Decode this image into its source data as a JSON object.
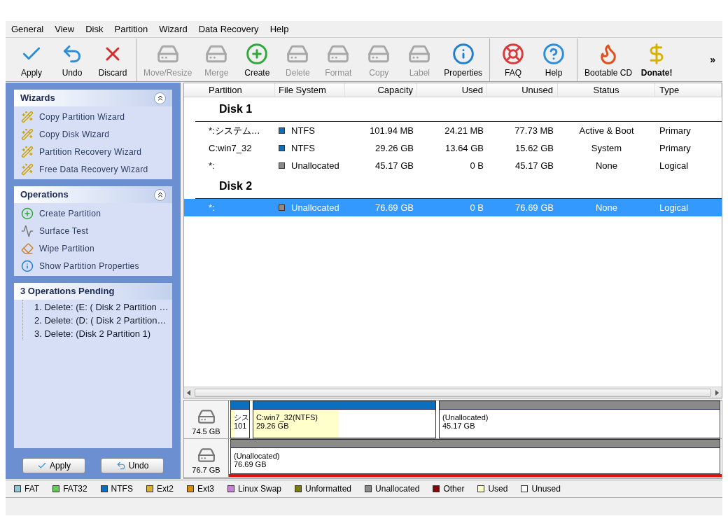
{
  "menu": [
    "General",
    "View",
    "Disk",
    "Partition",
    "Wizard",
    "Data Recovery",
    "Help"
  ],
  "toolbar": {
    "groups": [
      [
        {
          "label": "Apply",
          "disabled": false,
          "bold": false
        },
        {
          "label": "Undo",
          "disabled": false,
          "bold": false
        },
        {
          "label": "Discard",
          "disabled": false,
          "bold": false
        }
      ],
      [
        {
          "label": "Move/Resize",
          "disabled": true,
          "bold": false
        },
        {
          "label": "Merge",
          "disabled": true,
          "bold": false
        },
        {
          "label": "Create",
          "disabled": false,
          "bold": false
        },
        {
          "label": "Delete",
          "disabled": true,
          "bold": false
        },
        {
          "label": "Format",
          "disabled": true,
          "bold": false
        },
        {
          "label": "Copy",
          "disabled": true,
          "bold": false
        },
        {
          "label": "Label",
          "disabled": true,
          "bold": false
        },
        {
          "label": "Properties",
          "disabled": false,
          "bold": false
        }
      ],
      [
        {
          "label": "FAQ",
          "disabled": false,
          "bold": false
        },
        {
          "label": "Help",
          "disabled": false,
          "bold": false
        }
      ],
      [
        {
          "label": "Bootable CD",
          "disabled": false,
          "bold": false
        },
        {
          "label": "Donate!",
          "disabled": false,
          "bold": true
        }
      ]
    ],
    "overflow": "»"
  },
  "sidebar": {
    "wizards": {
      "title": "Wizards",
      "expanded": true,
      "items": [
        "Copy Partition Wizard",
        "Copy Disk Wizard",
        "Partition Recovery Wizard",
        "Free Data Recovery Wizard"
      ]
    },
    "operations": {
      "title": "Operations",
      "expanded": true,
      "items": [
        "Create Partition",
        "Surface Test",
        "Wipe Partition",
        "Show Partition Properties"
      ]
    },
    "pending": {
      "title": "3 Operations Pending",
      "items": [
        "1. Delete: (E: ( Disk 2 Partition …",
        "2. Delete: (D: ( Disk 2 Partition…",
        "3. Delete: (Disk 2 Partition 1)"
      ]
    },
    "buttons": [
      "Apply",
      "Undo"
    ]
  },
  "table": {
    "columns": [
      "Partition",
      "File System",
      "Capacity",
      "Used",
      "Unused",
      "Status",
      "Type"
    ],
    "rows": [
      {
        "kind": "disk",
        "label": "Disk 1"
      },
      {
        "kind": "partition",
        "selected": false,
        "partition": "*:システム…",
        "file_system": "NTFS",
        "color": "#0b6fc0",
        "capacity": "101.94 MB",
        "used": "24.21 MB",
        "unused": "77.73 MB",
        "status": "Active & Boot",
        "type": "Primary"
      },
      {
        "kind": "partition",
        "selected": false,
        "partition": "C:win7_32",
        "file_system": "NTFS",
        "color": "#0b6fc0",
        "capacity": "29.26 GB",
        "used": "13.64 GB",
        "unused": "15.62 GB",
        "status": "System",
        "type": "Primary"
      },
      {
        "kind": "partition",
        "selected": false,
        "partition": "*:",
        "file_system": "Unallocated",
        "color": "#8a8a8a",
        "capacity": "45.17 GB",
        "used": "0 B",
        "unused": "45.17 GB",
        "status": "None",
        "type": "Logical"
      },
      {
        "kind": "disk",
        "label": "Disk 2"
      },
      {
        "kind": "partition",
        "selected": true,
        "partition": "*:",
        "file_system": "Unallocated",
        "color": "#8a8a8a",
        "capacity": "76.69 GB",
        "used": "0 B",
        "unused": "76.69 GB",
        "status": "None",
        "type": "Logical"
      }
    ]
  },
  "disk_map": [
    {
      "size": "74.5 GB",
      "selected": false,
      "partitions": [
        {
          "name": "シス",
          "size": "101",
          "color": "#0b6fc0",
          "level": 0.24
        },
        {
          "name": "C:win7_32(NTFS)",
          "size": "29.26 GB",
          "color": "#0b6fc0",
          "level": 0.47
        },
        {
          "name": "(Unallocated)",
          "size": "45.17 GB",
          "color": "#8a8a8a"
        }
      ]
    },
    {
      "size": "76.7 GB",
      "selected": true,
      "partitions": [
        {
          "name": "(Unallocated)",
          "size": "76.69 GB",
          "color": "#8a8a8a"
        }
      ]
    }
  ],
  "legend": [
    {
      "label": "FAT",
      "color": "#8ec8d8"
    },
    {
      "label": "FAT32",
      "color": "#66cc55"
    },
    {
      "label": "NTFS",
      "color": "#0b6fc0"
    },
    {
      "label": "Ext2",
      "color": "#d9b030"
    },
    {
      "label": "Ext3",
      "color": "#d98a10"
    },
    {
      "label": "Linux Swap",
      "color": "#c77fd9"
    },
    {
      "label": "Unformatted",
      "color": "#7a7a10"
    },
    {
      "label": "Unallocated",
      "color": "#8a8a8a"
    },
    {
      "label": "Other",
      "color": "#8b0000"
    },
    {
      "label": "Used",
      "color": "#ffffcc"
    },
    {
      "label": "Unused",
      "color": "#ffffff"
    }
  ]
}
